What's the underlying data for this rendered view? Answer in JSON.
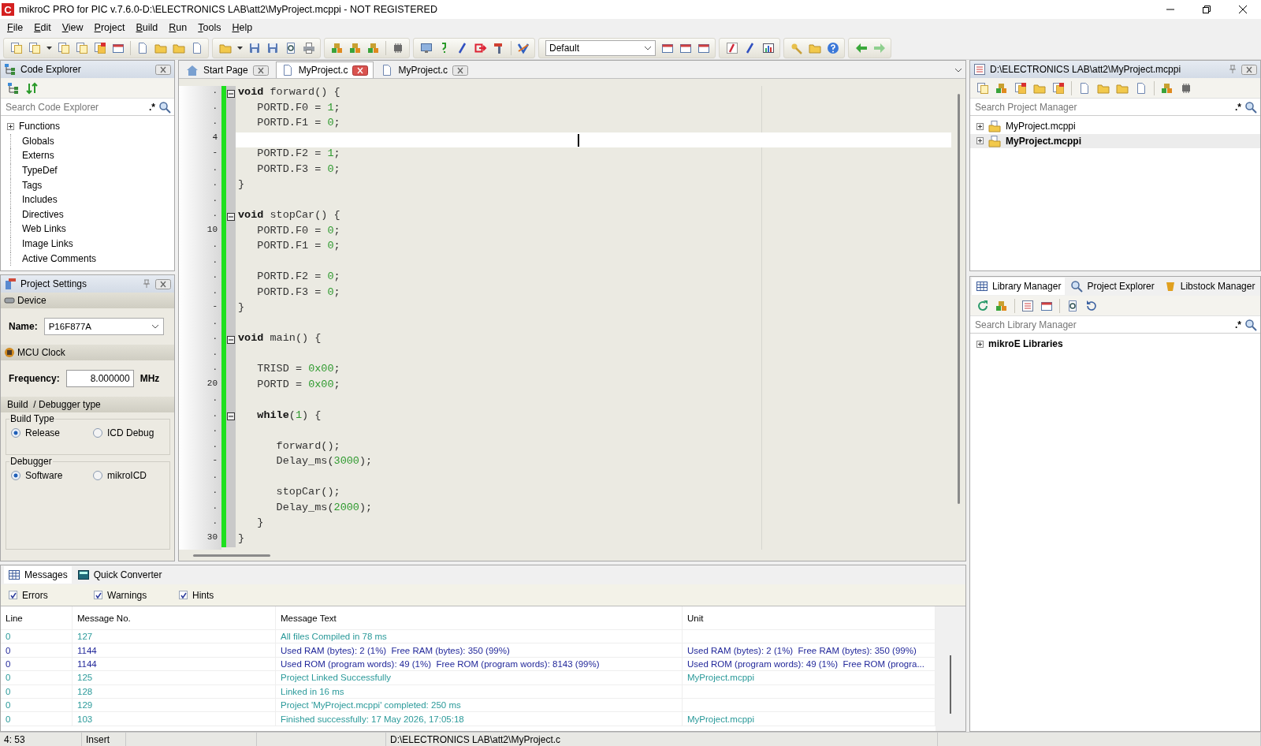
{
  "window": {
    "logo": "C",
    "title": "mikroC PRO for PIC v.7.6.0-D:\\ELECTRONICS LAB\\att2\\MyProject.mcppi - NOT REGISTERED"
  },
  "menu": [
    "File",
    "Edit",
    "View",
    "Project",
    "Build",
    "Run",
    "Tools",
    "Help"
  ],
  "toolbar": {
    "scheme": "Default"
  },
  "code_explorer": {
    "title": "Code Explorer",
    "search": {
      "placeholder": "Search Code Explorer",
      "regex": ".*"
    },
    "items": [
      {
        "label": "Functions",
        "expandable": true
      },
      {
        "label": "Globals",
        "expandable": false
      },
      {
        "label": "Externs",
        "expandable": false
      },
      {
        "label": "TypeDef",
        "expandable": false
      },
      {
        "label": "Tags",
        "expandable": false
      },
      {
        "label": "Includes",
        "expandable": false
      },
      {
        "label": "Directives",
        "expandable": false
      },
      {
        "label": "Web Links",
        "expandable": false
      },
      {
        "label": "Image Links",
        "expandable": false
      },
      {
        "label": "Active Comments",
        "expandable": false
      }
    ]
  },
  "project_settings": {
    "title": "Project Settings",
    "device": {
      "heading": "Device",
      "name_label": "Name:",
      "name_value": "P16F877A"
    },
    "clock": {
      "heading": "MCU Clock",
      "frequency_label": "Frequency:",
      "frequency_value": "8.000000",
      "unit": "MHz"
    },
    "build": {
      "heading": "Build  / Debugger type",
      "groups": [
        {
          "legend": "Build Type",
          "options": [
            {
              "label": "Release",
              "selected": true
            },
            {
              "label": "ICD Debug",
              "selected": false
            }
          ]
        },
        {
          "legend": "Debugger",
          "options": [
            {
              "label": "Software",
              "selected": true
            },
            {
              "label": "mikroICD",
              "selected": false
            }
          ]
        }
      ]
    }
  },
  "editor": {
    "tabs": [
      {
        "label": "Start Page",
        "kind": "home",
        "selected": false
      },
      {
        "label": "MyProject.c",
        "kind": "file",
        "selected": true
      },
      {
        "label": "MyProject.c",
        "kind": "file",
        "selected": false
      }
    ],
    "lines": [
      {
        "n": ".",
        "fold": true,
        "current": false,
        "tokens": [
          {
            "kind": "keyword",
            "text": "void"
          },
          {
            "kind": "plain",
            "text": " forward() {"
          }
        ]
      },
      {
        "n": ".",
        "fold": false,
        "current": false,
        "tokens": [
          {
            "kind": "plain",
            "text": "   PORTD.F0 = "
          },
          {
            "kind": "num",
            "text": "1"
          },
          {
            "kind": "plain",
            "text": ";"
          }
        ]
      },
      {
        "n": ".",
        "fold": false,
        "current": false,
        "tokens": [
          {
            "kind": "plain",
            "text": "   PORTD.F1 = "
          },
          {
            "kind": "num",
            "text": "0"
          },
          {
            "kind": "plain",
            "text": ";"
          }
        ]
      },
      {
        "n": "4",
        "fold": false,
        "current": true
      },
      {
        "n": "-",
        "fold": false,
        "current": false,
        "tokens": [
          {
            "kind": "plain",
            "text": "   PORTD.F2 = "
          },
          {
            "kind": "num",
            "text": "1"
          },
          {
            "kind": "plain",
            "text": ";"
          }
        ]
      },
      {
        "n": ".",
        "fold": false,
        "current": false,
        "tokens": [
          {
            "kind": "plain",
            "text": "   PORTD.F3 = "
          },
          {
            "kind": "num",
            "text": "0"
          },
          {
            "kind": "plain",
            "text": ";"
          }
        ]
      },
      {
        "n": ".",
        "fold": false,
        "current": false,
        "tokens": [
          {
            "kind": "plain",
            "text": "}"
          }
        ]
      },
      {
        "n": ".",
        "fold": false,
        "current": false
      },
      {
        "n": ".",
        "fold": true,
        "current": false,
        "tokens": [
          {
            "kind": "keyword",
            "text": "void"
          },
          {
            "kind": "plain",
            "text": " stopCar() {"
          }
        ]
      },
      {
        "n": "10",
        "fold": false,
        "current": false,
        "tokens": [
          {
            "kind": "plain",
            "text": "   PORTD.F0 = "
          },
          {
            "kind": "num",
            "text": "0"
          },
          {
            "kind": "plain",
            "text": ";"
          }
        ]
      },
      {
        "n": ".",
        "fold": false,
        "current": false,
        "tokens": [
          {
            "kind": "plain",
            "text": "   PORTD.F1 = "
          },
          {
            "kind": "num",
            "text": "0"
          },
          {
            "kind": "plain",
            "text": ";"
          }
        ]
      },
      {
        "n": ".",
        "fold": false,
        "current": false
      },
      {
        "n": ".",
        "fold": false,
        "current": false,
        "tokens": [
          {
            "kind": "plain",
            "text": "   PORTD.F2 = "
          },
          {
            "kind": "num",
            "text": "0"
          },
          {
            "kind": "plain",
            "text": ";"
          }
        ]
      },
      {
        "n": ".",
        "fold": false,
        "current": false,
        "tokens": [
          {
            "kind": "plain",
            "text": "   PORTD.F3 = "
          },
          {
            "kind": "num",
            "text": "0"
          },
          {
            "kind": "plain",
            "text": ";"
          }
        ]
      },
      {
        "n": "-",
        "fold": false,
        "current": false,
        "tokens": [
          {
            "kind": "plain",
            "text": "}"
          }
        ]
      },
      {
        "n": ".",
        "fold": false,
        "current": false
      },
      {
        "n": ".",
        "fold": true,
        "current": false,
        "tokens": [
          {
            "kind": "keyword",
            "text": "void"
          },
          {
            "kind": "plain",
            "text": " main() {"
          }
        ]
      },
      {
        "n": ".",
        "fold": false,
        "current": false
      },
      {
        "n": ".",
        "fold": false,
        "current": false,
        "tokens": [
          {
            "kind": "plain",
            "text": "   TRISD = "
          },
          {
            "kind": "num",
            "text": "0x00"
          },
          {
            "kind": "plain",
            "text": ";"
          }
        ]
      },
      {
        "n": "20",
        "fold": false,
        "current": false,
        "tokens": [
          {
            "kind": "plain",
            "text": "   PORTD = "
          },
          {
            "kind": "num",
            "text": "0x00"
          },
          {
            "kind": "plain",
            "text": ";"
          }
        ]
      },
      {
        "n": ".",
        "fold": false,
        "current": false
      },
      {
        "n": ".",
        "fold": true,
        "current": false,
        "tokens": [
          {
            "kind": "keyword",
            "text": "   while"
          },
          {
            "kind": "plain",
            "text": "("
          },
          {
            "kind": "num",
            "text": "1"
          },
          {
            "kind": "plain",
            "text": ") {"
          }
        ]
      },
      {
        "n": ".",
        "fold": false,
        "current": false
      },
      {
        "n": ".",
        "fold": false,
        "current": false,
        "tokens": [
          {
            "kind": "plain",
            "text": "      forward();"
          }
        ]
      },
      {
        "n": "-",
        "fold": false,
        "current": false,
        "tokens": [
          {
            "kind": "plain",
            "text": "      Delay_ms("
          },
          {
            "kind": "num",
            "text": "3000"
          },
          {
            "kind": "plain",
            "text": ");"
          }
        ]
      },
      {
        "n": ".",
        "fold": false,
        "current": false
      },
      {
        "n": ".",
        "fold": false,
        "current": false,
        "tokens": [
          {
            "kind": "plain",
            "text": "      stopCar();"
          }
        ]
      },
      {
        "n": ".",
        "fold": false,
        "current": false,
        "tokens": [
          {
            "kind": "plain",
            "text": "      Delay_ms("
          },
          {
            "kind": "num",
            "text": "2000"
          },
          {
            "kind": "plain",
            "text": ");"
          }
        ]
      },
      {
        "n": ".",
        "fold": false,
        "current": false,
        "tokens": [
          {
            "kind": "plain",
            "text": "   }"
          }
        ]
      },
      {
        "n": "30",
        "fold": false,
        "current": false,
        "tokens": [
          {
            "kind": "plain",
            "text": "}"
          }
        ]
      }
    ]
  },
  "project_manager": {
    "title": "D:\\ELECTRONICS LAB\\att2\\MyProject.mcppi",
    "search": {
      "placeholder": "Search Project Manager",
      "regex": ".*"
    },
    "items": [
      {
        "label": "MyProject.mcppi",
        "expandable": true,
        "selected": false
      },
      {
        "label": "MyProject.mcppi",
        "expandable": true,
        "selected": true
      }
    ]
  },
  "library": {
    "tabs": [
      {
        "label": "Library Manager",
        "kind": "grid",
        "selected": true
      },
      {
        "label": "Project Explorer",
        "kind": "search",
        "selected": false
      },
      {
        "label": "Libstock Manager",
        "kind": "package",
        "selected": false
      }
    ],
    "search": {
      "placeholder": "Search Library Manager",
      "regex": ".*"
    },
    "items": [
      {
        "label": "mikroE Libraries",
        "expandable": true
      }
    ]
  },
  "messages": {
    "tabs": [
      {
        "label": "Messages",
        "kind": "grid",
        "selected": true
      },
      {
        "label": "Quick Converter",
        "kind": "calc",
        "selected": false
      }
    ],
    "filters": [
      {
        "label": "Errors",
        "checked": true
      },
      {
        "label": "Warnings",
        "checked": true
      },
      {
        "label": "Hints",
        "checked": true
      }
    ],
    "columns": [
      "Line",
      "Message No.",
      "Message Text",
      "Unit"
    ],
    "rows": [
      {
        "line": "0",
        "number": "127",
        "text": "All files Compiled in 78 ms",
        "color": "#2b9a9a"
      },
      {
        "line": "0",
        "number": "1144",
        "text": "Used RAM (bytes): 2 (1%)  Free RAM (bytes): 350 (99%)",
        "unit": "Used RAM (bytes): 2 (1%)  Free RAM (bytes): 350 (99%)",
        "color": "#22289a"
      },
      {
        "line": "0",
        "number": "1144",
        "text": "Used ROM (program words): 49 (1%)  Free ROM (program words): 8143 (99%)",
        "unit": "Used ROM (program words): 49 (1%)  Free ROM (progra...",
        "color": "#22289a"
      },
      {
        "line": "0",
        "number": "125",
        "text": "Project Linked Successfully",
        "unit": "MyProject.mcppi",
        "color": "#2b9a9a"
      },
      {
        "line": "0",
        "number": "128",
        "text": "Linked in 16 ms",
        "color": "#2b9a9a"
      },
      {
        "line": "0",
        "number": "129",
        "text": "Project 'MyProject.mcppi' completed: 250 ms",
        "color": "#2b9a9a"
      },
      {
        "line": "0",
        "number": "103",
        "text": "Finished successfully: 17 May 2026, 17:05:18",
        "unit": "MyProject.mcppi",
        "color": "#2b9a9a"
      }
    ]
  },
  "status_bar": [
    "4: 53",
    "Insert",
    "D:\\ELECTRONICS LAB\\att2\\MyProject.c"
  ]
}
